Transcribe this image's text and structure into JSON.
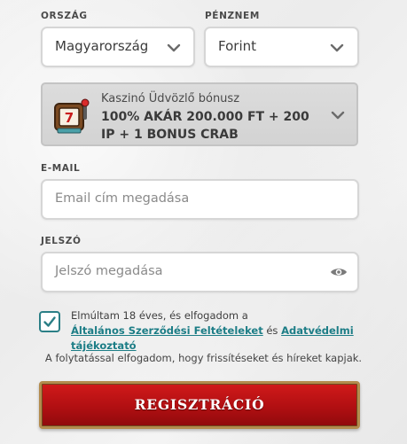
{
  "country": {
    "label": "ORSZÁG",
    "value": "Magyarország",
    "icon": "chevron-down-icon"
  },
  "currency": {
    "label": "PÉNZNEM",
    "value": "Forint",
    "icon": "chevron-down-icon"
  },
  "bonus": {
    "title": "Kaszinó Üdvözlő bónusz",
    "offer": "100% AKÁR 200.000 FT + 200 IP + 1 BONUS CRAB",
    "icon": "slot-machine-icon"
  },
  "email": {
    "label": "E-MAIL",
    "placeholder": "Email cím megadása"
  },
  "password": {
    "label": "JELSZÓ",
    "placeholder": "Jelszó megadása",
    "icon": "eye-icon"
  },
  "terms": {
    "text_before": "Elmúltam 18 éves, és elfogadom a",
    "link_terms": "Általános Szerződési Feltételeket",
    "conjunction": "és",
    "link_privacy": "Adatvédelmi tájékoztató",
    "checked": true
  },
  "notice": "A folytatással elfogadom, hogy frissítéseket és híreket kapjak.",
  "submit": {
    "label": "REGISZTRÁCIÓ"
  },
  "colors": {
    "accent": "#1c7d86",
    "button_red": "#c0141a",
    "button_border": "#b38b4d"
  }
}
